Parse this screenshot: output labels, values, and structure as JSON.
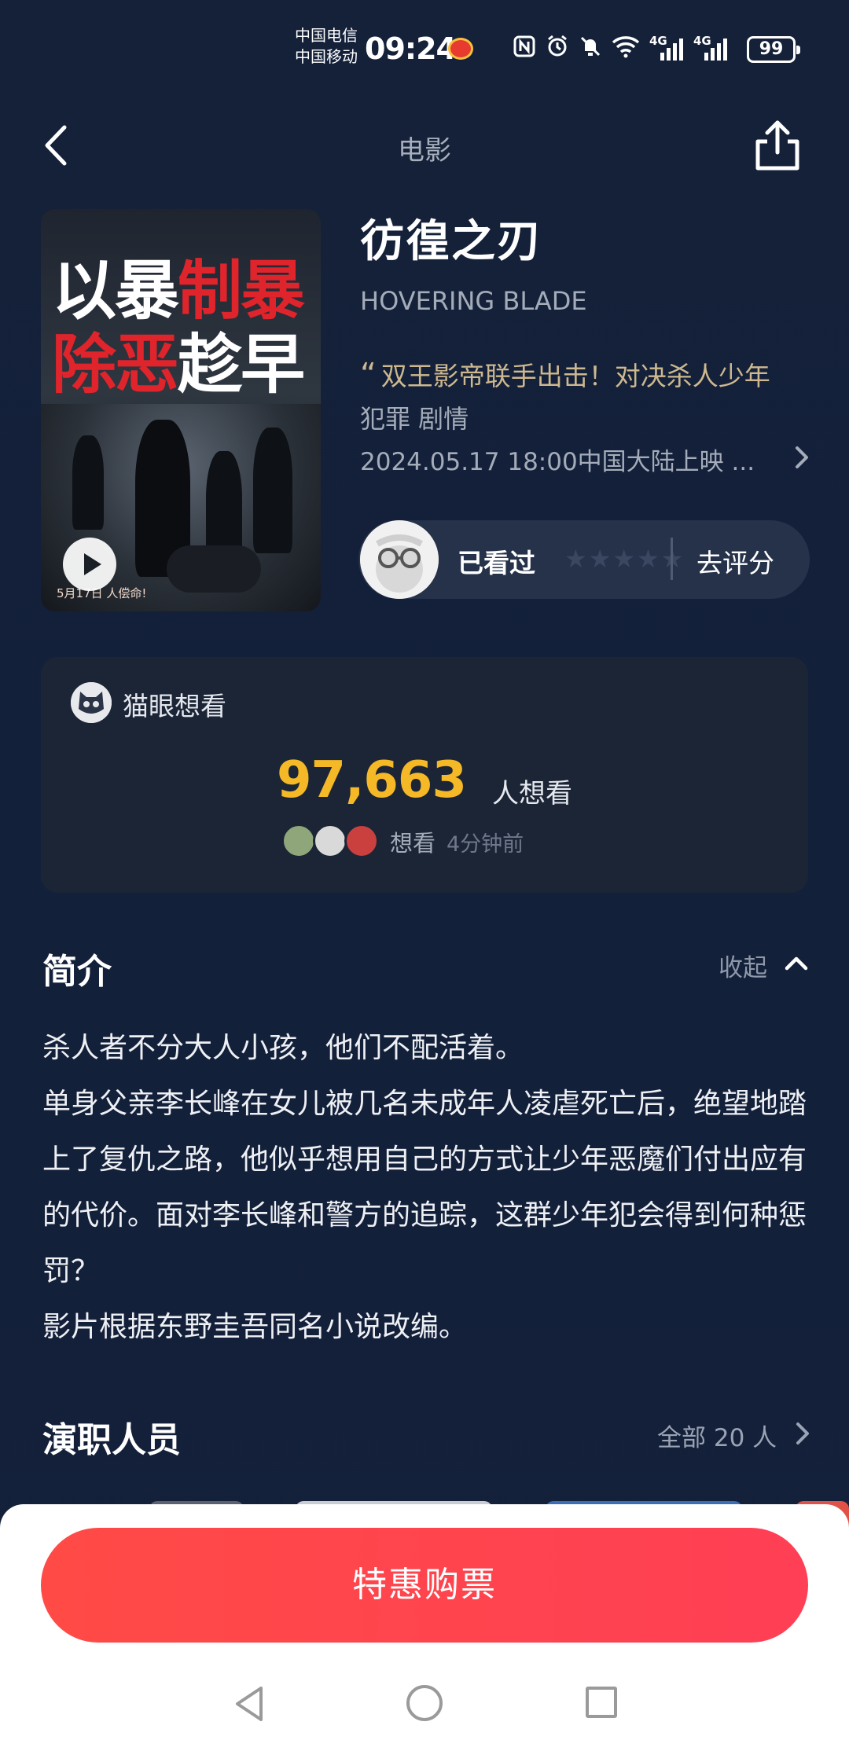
{
  "status_bar": {
    "carrier_1": "中国电信",
    "carrier_2": "中国移动",
    "time": "09:24",
    "net_1": "4G",
    "net_2": "4G",
    "battery": "99"
  },
  "header": {
    "title": "电影"
  },
  "movie": {
    "title": "彷徨之刃",
    "title_en": "HOVERING BLADE",
    "slogan": "双王影帝联手出击！对决杀人少年",
    "genre": "犯罪 剧情",
    "release": "2024.05.17 18:00中国大陆上映 ...",
    "poster": {
      "line1_white": "以暴",
      "line1_red": "制暴",
      "line2_red": "除恶",
      "line2_white": "趁早",
      "tagline": "5月17日 人偿命!"
    }
  },
  "rating": {
    "watched_label": "已看过",
    "stars": "★★★★★",
    "rate_link": "去评分"
  },
  "want": {
    "source_label": "猫眼想看",
    "count": "97,663",
    "count_suffix": "人想看",
    "recent_action": "想看",
    "recent_time": "4分钟前"
  },
  "intro": {
    "title": "简介",
    "collapse_label": "收起",
    "paragraphs": [
      "杀人者不分大人小孩，他们不配活着。",
      "单身父亲李长峰在女儿被几名未成年人凌虐死亡后，绝望地踏上了复仇之路，他似乎想用自己的方式让少年恶魔们付出应有的代价。面对李长峰和警方的追踪，这群少年犯会得到何种惩罚？",
      "影片根据东野圭吾同名小说改编。"
    ]
  },
  "cast": {
    "title": "演职人员",
    "all_label": "全部 20 人"
  },
  "buy": {
    "label": "特惠购票"
  },
  "colors": {
    "background": "#13203a",
    "accent_red": "#ff4a46",
    "want_yellow": "#f5b826",
    "slogan_gold": "#cdb88f"
  },
  "icons": {
    "back": "chevron-left-icon",
    "share": "share-icon",
    "play": "play-icon",
    "cat": "maoyan-cat-icon",
    "collapse": "chevron-up-icon",
    "more": "chevron-right-icon"
  }
}
